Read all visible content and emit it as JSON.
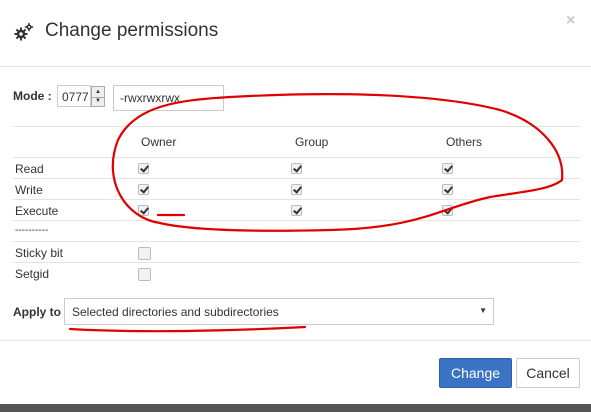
{
  "header": {
    "title": "Change permissions",
    "close_glyph": "×",
    "icon": "gears-icon"
  },
  "mode": {
    "label": "Mode :",
    "number_value": "0777",
    "symbolic_value": "-rwxrwxrwx"
  },
  "columns": [
    "Owner",
    "Group",
    "Others"
  ],
  "permissions": [
    {
      "label": "Read",
      "owner": true,
      "group": true,
      "others": true
    },
    {
      "label": "Write",
      "owner": true,
      "group": true,
      "others": true
    },
    {
      "label": "Execute",
      "owner": true,
      "group": true,
      "others": true
    }
  ],
  "separator_text": "----------",
  "special": [
    {
      "label": "Sticky bit",
      "checked": false
    },
    {
      "label": "Setgid",
      "checked": false
    }
  ],
  "apply": {
    "label": "Apply to",
    "selected": "Selected directories and subdirectories",
    "arrow_glyph": "▼"
  },
  "buttons": {
    "change": "Change",
    "cancel": "Cancel"
  },
  "colors": {
    "primary": "#3a72c4",
    "annotation": "#e00000"
  }
}
